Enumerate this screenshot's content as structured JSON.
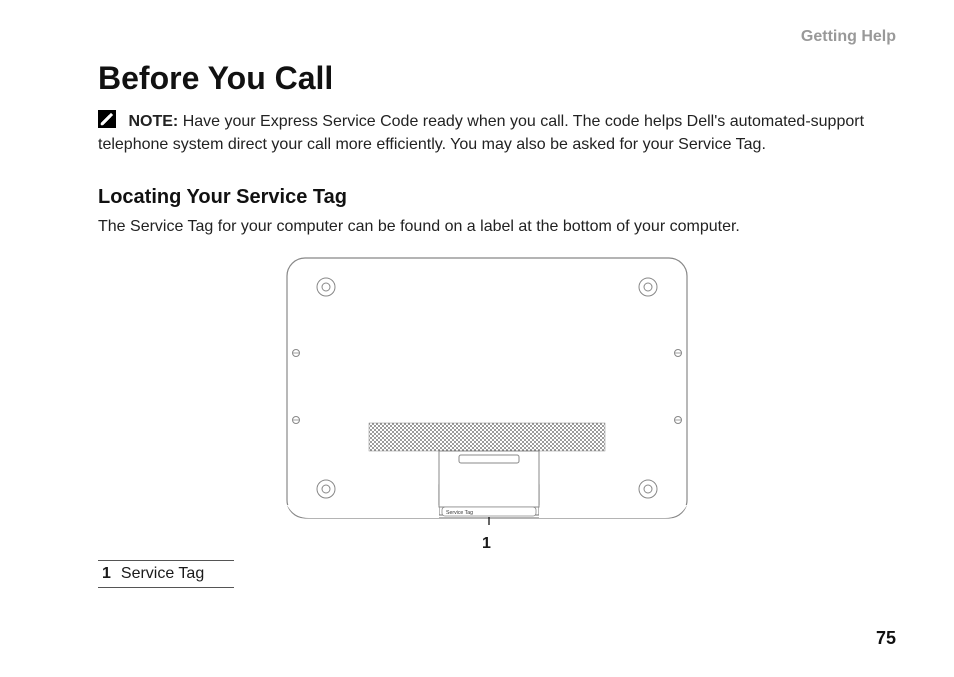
{
  "header": {
    "section_label": "Getting Help"
  },
  "heading": "Before You Call",
  "note": {
    "label": "NOTE:",
    "text": "Have your Express Service Code ready when you call. The code helps Dell's automated-support telephone system direct your call more efficiently. You may also be asked for your Service Tag."
  },
  "subheading": "Locating Your Service Tag",
  "body_text": "The Service Tag for your computer can be found on a label at the bottom of your computer.",
  "illustration": {
    "service_tag_label": "Service Tag",
    "callout_number": "1"
  },
  "legend": {
    "number": "1",
    "text": "Service Tag"
  },
  "page_number": "75"
}
